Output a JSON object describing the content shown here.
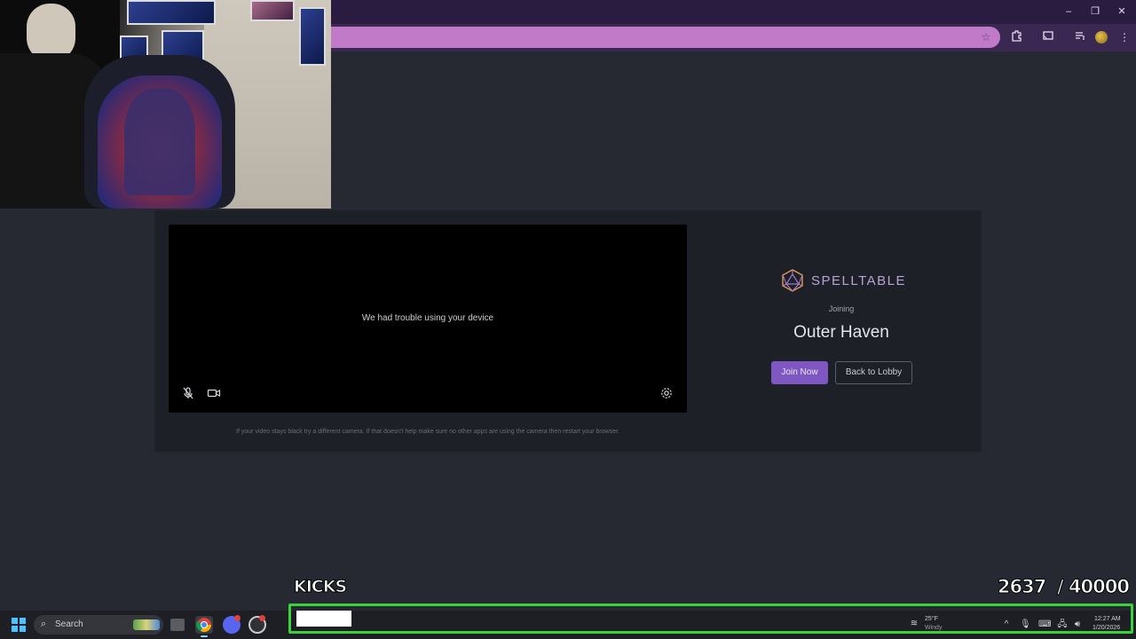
{
  "browser": {
    "window_controls": [
      "–",
      "❐",
      "✕"
    ],
    "toolbar_icons": [
      "star-icon",
      "extensions-icon",
      "cast-icon",
      "media-icon",
      "profile-avatar",
      "menu-icon"
    ]
  },
  "preview": {
    "message": "We had trouble using your device",
    "hint": "If your video stays black try a different camera. If that doesn't help make sure no other apps are using the camera then restart your browser.",
    "icons": [
      "mic-off-icon",
      "camera-icon",
      "settings-icon"
    ]
  },
  "join_panel": {
    "brand": "SPELLTABLE",
    "joining_label": "Joining",
    "room_name": "Outer Haven",
    "join_button": "Join Now",
    "back_button": "Back to Lobby"
  },
  "overlay": {
    "goal_label": "KICKS",
    "current": "2637",
    "goal": "40000",
    "counter_text": "2637  / 40000",
    "progress_fraction": 0.066,
    "accent": "#3bd13b"
  },
  "taskbar": {
    "search_label": "Search",
    "weather_temp": "25°F",
    "weather_desc": "Windy",
    "time": "12:27 AM",
    "date": "1/20/2026"
  },
  "colors": {
    "page_bg": "#262932",
    "card_bg": "#1e2027",
    "primary_button": "#7e57c2",
    "titlebar": "#2a1b40",
    "address_bar": "#c07ac8"
  }
}
